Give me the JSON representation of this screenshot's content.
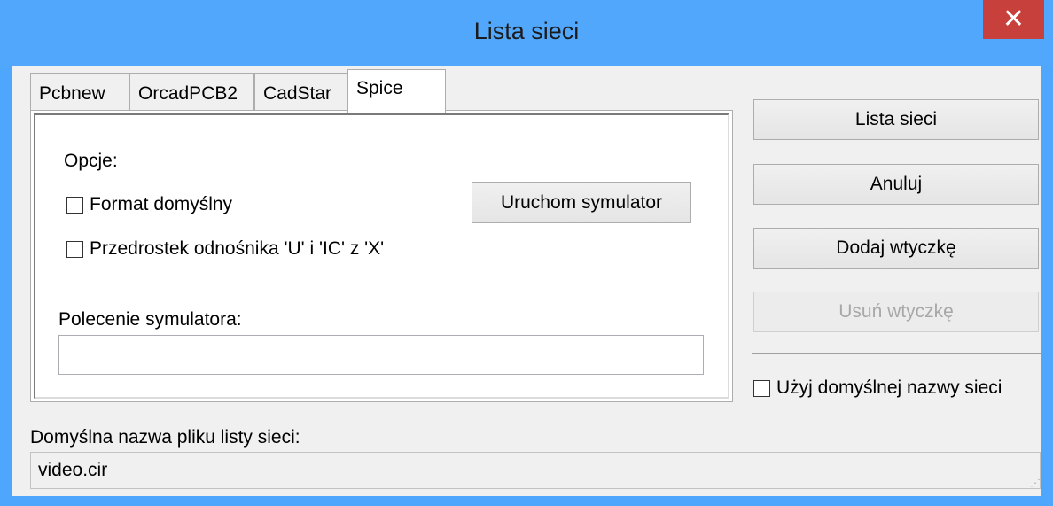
{
  "window": {
    "title": "Lista sieci",
    "close_symbol": "✕"
  },
  "tabs": [
    {
      "label": "Pcbnew",
      "active": false
    },
    {
      "label": "OrcadPCB2",
      "active": false
    },
    {
      "label": "CadStar",
      "active": false
    },
    {
      "label": "Spice",
      "active": true
    }
  ],
  "spice": {
    "options_label": "Opcje:",
    "default_format_label": "Format domyślny",
    "prefix_label": "Przedrostek odnośnika 'U' i 'IC' z 'X'",
    "run_simulator_label": "Uruchom symulator",
    "simulator_command_label": "Polecenie symulatora:",
    "simulator_command_value": ""
  },
  "actions": {
    "netlist_label": "Lista sieci",
    "cancel_label": "Anuluj",
    "add_plugin_label": "Dodaj wtyczkę",
    "remove_plugin_label": "Usuń wtyczkę",
    "use_default_name_label": "Użyj domyślnej nazwy sieci"
  },
  "filename": {
    "label": "Domyślna nazwa pliku listy sieci:",
    "value": "video.cir"
  }
}
